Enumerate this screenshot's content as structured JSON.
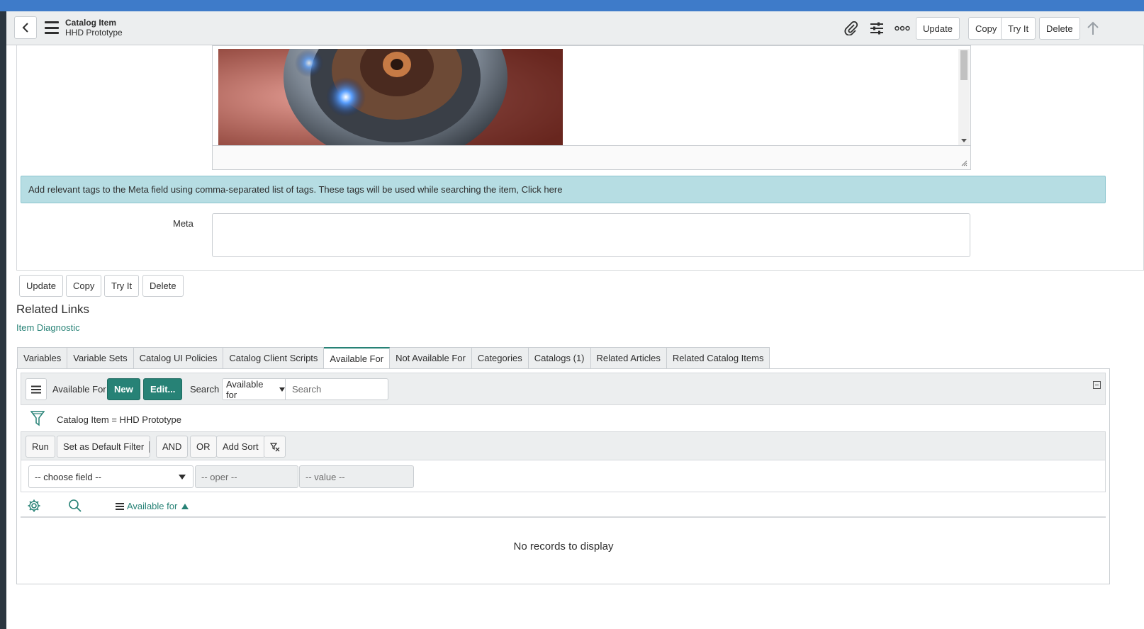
{
  "colors": {
    "accent": "#278276",
    "topbar": "#3e7bc9",
    "info_bg": "#b6dde3"
  },
  "header": {
    "record_type": "Catalog Item",
    "record_name": "HHD Prototype",
    "icons": [
      "back-arrow-icon",
      "menu-icon",
      "paperclip-icon",
      "sliders-icon",
      "more-icon",
      "scroll-up-icon"
    ],
    "buttons": {
      "update": "Update",
      "copy": "Copy",
      "try_it": "Try It",
      "delete": "Delete"
    }
  },
  "form": {
    "info_message": "Add relevant tags to the Meta field using comma-separated list of tags. These tags will be used while searching the item, Click here",
    "meta_label": "Meta",
    "meta_value": "",
    "buttons": {
      "update": "Update",
      "copy": "Copy",
      "try_it": "Try It",
      "delete": "Delete"
    }
  },
  "related_links": {
    "title": "Related Links",
    "items": [
      "Item Diagnostic"
    ]
  },
  "tabs": [
    {
      "label": "Variables",
      "active": false
    },
    {
      "label": "Variable Sets",
      "active": false
    },
    {
      "label": "Catalog UI Policies",
      "active": false
    },
    {
      "label": "Catalog Client Scripts",
      "active": false
    },
    {
      "label": "Available For",
      "active": true
    },
    {
      "label": "Not Available For",
      "active": false
    },
    {
      "label": "Categories",
      "active": false
    },
    {
      "label": "Catalogs (1)",
      "active": false
    },
    {
      "label": "Related Articles",
      "active": false
    },
    {
      "label": "Related Catalog Items",
      "active": false
    }
  ],
  "list": {
    "title": "Available For",
    "new_label": "New",
    "edit_label": "Edit...",
    "search_label": "Search",
    "search_field": "Available for",
    "search_placeholder": "Search",
    "breadcrumb": "Catalog Item = HHD Prototype",
    "filter_buttons": {
      "run": "Run",
      "set_default": "Set as Default Filter",
      "and": "AND",
      "or": "OR",
      "add_sort": "Add Sort"
    },
    "condition": {
      "field": "-- choose field --",
      "oper": "-- oper --",
      "value": "-- value --"
    },
    "column": "Available for",
    "empty_message": "No records to display"
  }
}
